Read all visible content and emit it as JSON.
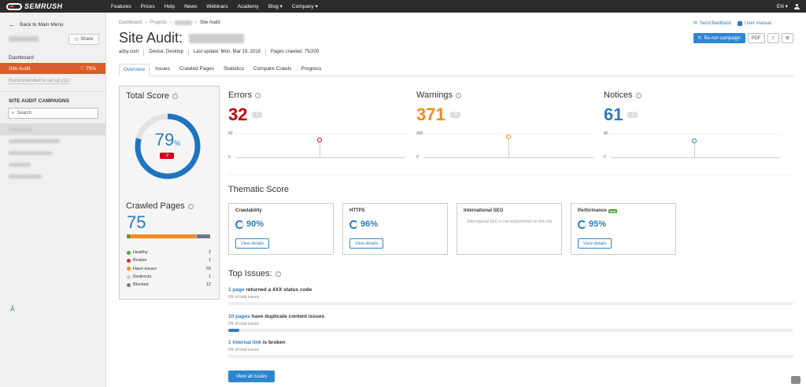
{
  "topbar": {
    "logo_text": "SEMRUSH",
    "nav": [
      "Features",
      "Prices",
      "Help",
      "News",
      "Webinars",
      "Academy",
      "Blog ▾",
      "Company ▾"
    ],
    "lang": "EN ▾"
  },
  "sidebar": {
    "back": "Back to Main Menu",
    "share": "Share",
    "dashboard": "Dashboard",
    "active": "Site Audit",
    "active_score": "79%",
    "recommended": "Recommended to set up (11)",
    "campaigns_title": "SITE AUDIT CAMPAIGNS",
    "search_placeholder": "Search"
  },
  "breadcrumb": {
    "items": [
      "Dashboard",
      "Projects"
    ],
    "current": "Site Audit"
  },
  "page": {
    "title": "Site Audit:",
    "domain": "adsy.com",
    "device": "Device: Desktop",
    "last_update": "Last update: Mon, Mar 19, 2018",
    "pages_crawled": "Pages crawled: 75/200"
  },
  "actions": {
    "feedback": "Send feedback",
    "manual": "User manual",
    "rerun": "Re-run campaign",
    "pdf": "PDF"
  },
  "tabs": [
    "Overview",
    "Issues",
    "Crawled Pages",
    "Statistics",
    "Compare Crawls",
    "Progress"
  ],
  "total_score": {
    "title": "Total Score",
    "value": "79",
    "unit": "%",
    "change": "-2",
    "fraction": 0.79
  },
  "crawled": {
    "title": "Crawled Pages",
    "value": "75",
    "legend": [
      {
        "label": "Healthy",
        "count": "2",
        "color": "#4aaa3d"
      },
      {
        "label": "Broken",
        "count": "1",
        "color": "#c0392b"
      },
      {
        "label": "Have issues",
        "count": "59",
        "color": "#f28a1c"
      },
      {
        "label": "Redirects",
        "count": "1",
        "color": "#cccccc"
      },
      {
        "label": "Blocked",
        "count": "12",
        "color": "#6a7a88"
      }
    ]
  },
  "metrics": [
    {
      "title": "Errors",
      "value": "32",
      "badge": "0",
      "color": "#c00000",
      "y_top": "40",
      "y_bottom": "0"
    },
    {
      "title": "Warnings",
      "value": "371",
      "badge": "0",
      "color": "#f28a1c",
      "y_top": "400",
      "y_bottom": "0"
    },
    {
      "title": "Notices",
      "value": "61",
      "badge": "0",
      "color": "#2e7cc0",
      "y_top": "80",
      "y_bottom": "0"
    }
  ],
  "thematic": {
    "title": "Thematic Score",
    "cards": [
      {
        "title": "Crawlability",
        "value": "90%",
        "button": "View details"
      },
      {
        "title": "HTTPS",
        "value": "96%",
        "button": "View details"
      },
      {
        "title": "International SEO",
        "note": "International SEO is not implemented on this site."
      },
      {
        "title": "Performance",
        "badge": "new",
        "value": "95%",
        "button": "View details"
      }
    ]
  },
  "top_issues": {
    "title": "Top Issues:",
    "items": [
      {
        "link": "1 page",
        "text": " returned a 4XX status code",
        "sub": "0% of total issues",
        "pct": 0
      },
      {
        "link": "10 pages",
        "text": " have duplicate content issues",
        "sub": "2% of total issues",
        "pct": 2
      },
      {
        "link": "1 internal link",
        "text": " is broken",
        "sub": "0% of total issues",
        "pct": 0
      }
    ],
    "button": "View all issues"
  }
}
